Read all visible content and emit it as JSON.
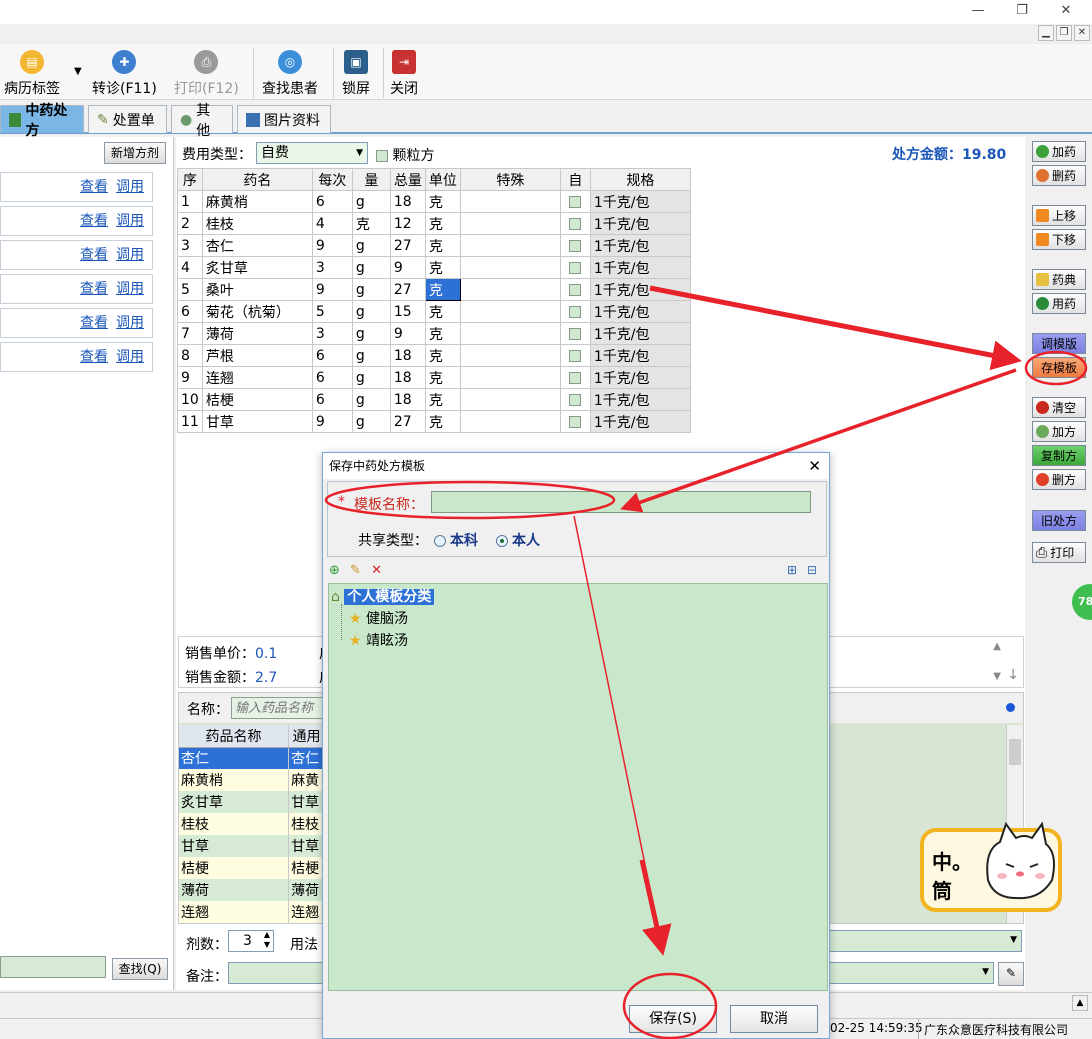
{
  "toolbar": {
    "items": [
      "病历标签",
      "转诊(F11)",
      "打印(F12)",
      "查找患者",
      "锁屏",
      "关闭"
    ]
  },
  "tabs": [
    "中药处方",
    "处置单",
    "其他",
    "图片资料"
  ],
  "left": {
    "new_button": "新增方剂",
    "row_view": "查看",
    "row_use": "调用",
    "find_button": "查找(Q)"
  },
  "fee": {
    "label": "费用类型：",
    "value": "自费",
    "granule_label": "颗粒方",
    "amount_label": "处方金额：",
    "amount_value": "19.80"
  },
  "grid": {
    "headers": [
      "序",
      "药名",
      "每次",
      "量",
      "总量",
      "单位",
      "特殊",
      "自",
      "规格"
    ],
    "rows": [
      [
        "1",
        "麻黄梢",
        "6",
        "g",
        "18",
        "克",
        "",
        "",
        "1千克/包"
      ],
      [
        "2",
        "桂枝",
        "4",
        "克",
        "12",
        "克",
        "",
        "",
        "1千克/包"
      ],
      [
        "3",
        "杏仁",
        "9",
        "g",
        "27",
        "克",
        "",
        "",
        "1千克/包"
      ],
      [
        "4",
        "炙甘草",
        "3",
        "g",
        "9",
        "克",
        "",
        "",
        "1千克/包"
      ],
      [
        "5",
        "桑叶",
        "9",
        "g",
        "27",
        "克",
        "",
        "",
        "1千克/包"
      ],
      [
        "6",
        "菊花（杭菊）",
        "5",
        "g",
        "15",
        "克",
        "",
        "",
        "1千克/包"
      ],
      [
        "7",
        "薄荷",
        "3",
        "g",
        "9",
        "克",
        "",
        "",
        "1千克/包"
      ],
      [
        "8",
        "芦根",
        "6",
        "g",
        "18",
        "克",
        "",
        "",
        "1千克/包"
      ],
      [
        "9",
        "连翘",
        "6",
        "g",
        "18",
        "克",
        "",
        "",
        "1千克/包"
      ],
      [
        "10",
        "桔梗",
        "6",
        "g",
        "18",
        "克",
        "",
        "",
        "1千克/包"
      ],
      [
        "11",
        "甘草",
        "9",
        "g",
        "27",
        "克",
        "",
        "",
        "1千克/包"
      ]
    ]
  },
  "info": {
    "unit_price_label": "销售单价：",
    "unit_price": "0.1",
    "amount_label": "销售金额：",
    "amount": "2.7",
    "cut1": "广",
    "cut2": "广"
  },
  "drug_search": {
    "label": "名称：",
    "placeholder": "输入药品名称",
    "col_name": "药品名称",
    "col_common": "通用",
    "rows": [
      [
        "杏仁",
        "杏仁"
      ],
      [
        "麻黄梢",
        "麻黄"
      ],
      [
        "炙甘草",
        "甘草"
      ],
      [
        "桂枝",
        "桂枝"
      ],
      [
        "甘草",
        "甘草"
      ],
      [
        "桔梗",
        "桔梗"
      ],
      [
        "薄荷",
        "薄荷"
      ],
      [
        "连翘",
        "连翘"
      ]
    ]
  },
  "bottom": {
    "dose_label": "剂数：",
    "dose_value": "3",
    "usage_label": "用法",
    "note_label": "备注："
  },
  "right_buttons": [
    "加药",
    "删药",
    "上移",
    "下移",
    "药典",
    "用药",
    "调模版",
    "存模板",
    "清空",
    "加方",
    "复制方",
    "删方",
    "旧处方",
    "打印"
  ],
  "side_badge": "78",
  "status": {
    "datetime": "02-25 14:59:35",
    "company": "广东众意医疗科技有限公司"
  },
  "dialog": {
    "title": "保存中药处方模板",
    "required_mark": "*",
    "name_label": "模板名称：",
    "name_value": "",
    "share_label": "共享类型：",
    "share_dept": "本科",
    "share_self": "本人",
    "tree_root": "个人模板分类",
    "tree_items": [
      "健脑汤",
      "靖眩汤"
    ],
    "save_button": "保存(S)",
    "cancel_button": "取消"
  },
  "mascot_text": "中。筒",
  "colors": {
    "annotation": "#e8222a",
    "tab_active": "#7ab6e6",
    "link": "#1a56b8",
    "tree_bg": "#c9e8cb"
  }
}
